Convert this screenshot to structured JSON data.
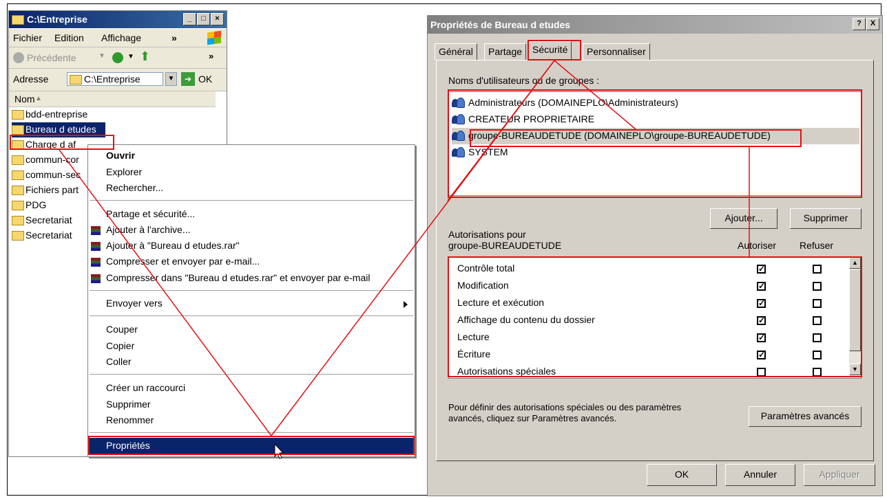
{
  "explorer": {
    "title": "C:\\Entreprise",
    "menu": [
      "Fichier",
      "Edition",
      "Affichage"
    ],
    "menu_more": "»",
    "toolbar_back": "Précédente",
    "toolbar_more": "»",
    "address_label": "Adresse",
    "address_value": "C:\\Entreprise",
    "go_label": "OK",
    "column_name": "Nom",
    "files": [
      "bdd-entreprise",
      "Bureau d etudes",
      "Charge d af",
      "commun-cor",
      "commun-sec",
      "Fichiers part",
      "PDG",
      "Secretariat",
      "Secretariat"
    ]
  },
  "context_menu": {
    "items": [
      "Ouvrir",
      "Explorer",
      "Rechercher...",
      "Partage et sécurité...",
      "Ajouter à l'archive...",
      "Ajouter à \"Bureau d etudes.rar\"",
      "Compresser et envoyer par e-mail...",
      "Compresser dans \"Bureau d etudes.rar\" et envoyer par e-mail",
      "Envoyer vers",
      "Couper",
      "Copier",
      "Coller",
      "Créer un raccourci",
      "Supprimer",
      "Renommer",
      "Propriétés"
    ]
  },
  "dialog": {
    "title": "Propriétés de Bureau d etudes",
    "help_btn": "?",
    "close_btn": "X",
    "tabs": [
      "Général",
      "Partage",
      "Sécurité",
      "Personnaliser"
    ],
    "users_label": "Noms d'utilisateurs ou de groupes :",
    "users": [
      "Administrateurs (DOMAINEPLO\\Administrateurs)",
      "CREATEUR PROPRIETAIRE",
      "groupe-BUREAUDETUDE (DOMAINEPLO\\groupe-BUREAUDETUDE)",
      "SYSTEM"
    ],
    "add_btn": "Ajouter...",
    "remove_btn": "Supprimer",
    "perms_for_label": "Autorisations pour",
    "perms_for_group": "groupe-BUREAUDETUDE",
    "allow_label": "Autoriser",
    "deny_label": "Refuser",
    "permissions": [
      {
        "name": "Contrôle total",
        "allow": true,
        "deny": false
      },
      {
        "name": "Modification",
        "allow": true,
        "deny": false
      },
      {
        "name": "Lecture et exécution",
        "allow": true,
        "deny": false
      },
      {
        "name": "Affichage du contenu du dossier",
        "allow": true,
        "deny": false
      },
      {
        "name": "Lecture",
        "allow": true,
        "deny": false
      },
      {
        "name": "Écriture",
        "allow": true,
        "deny": false
      },
      {
        "name": "Autorisations spéciales",
        "allow": false,
        "deny": false
      }
    ],
    "advanced_text_1": "Pour définir des autorisations spéciales ou des paramètres",
    "advanced_text_2": "avancés, cliquez sur Paramètres avancés.",
    "advanced_btn": "Paramètres avancés",
    "ok_btn": "OK",
    "cancel_btn": "Annuler",
    "apply_btn": "Appliquer"
  },
  "colors": {
    "highlight": "#0a246a",
    "annotation_red": "#e01010",
    "dialog_face": "#d4d0c8"
  }
}
